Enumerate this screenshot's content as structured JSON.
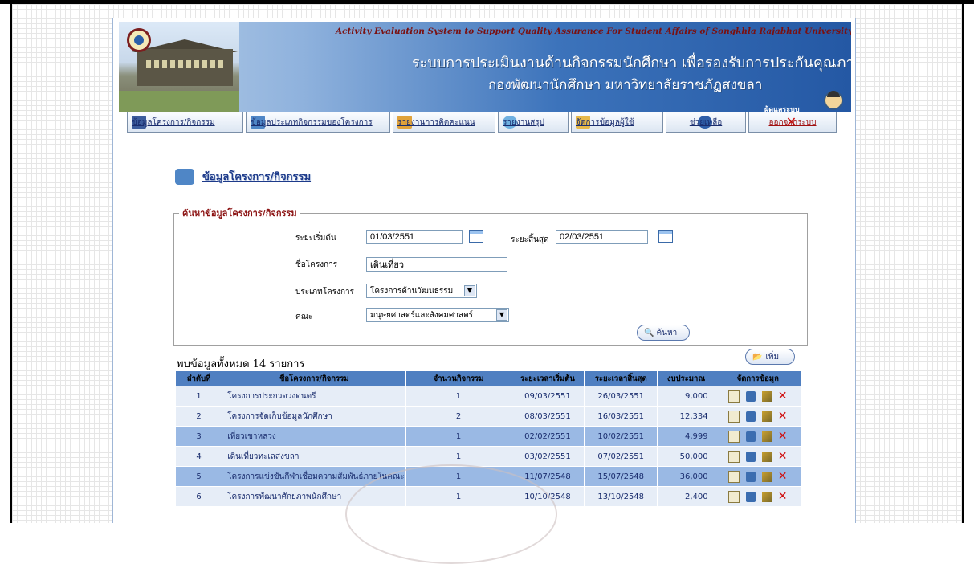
{
  "banner": {
    "title_en": "Activity Evaluation System to Support Quality Assurance For Student Affairs of Songkhla Rajabhat University",
    "title_th_1": "ระบบการประเมินงานด้านกิจกรรมนักศึกษา เพื่อรองรับการประกันคุณภาพ",
    "title_th_2": "กองพัฒนานักศึกษา มหาวิทยาลัยราชภัฏสงขลา",
    "user_label": "ผู้ดูแลระบบ"
  },
  "nav": [
    {
      "label": "ข้อมูลโครงการ/กิจกรรม",
      "icon": "monitor-icon"
    },
    {
      "label": "ข้อมูลประเภทกิจกรรมของโครงการ",
      "icon": "folder-icon"
    },
    {
      "label": "รายงานการคิดคะแนน",
      "icon": "report-icon"
    },
    {
      "label": "รายงานสรุป",
      "icon": "chart-icon"
    },
    {
      "label": "จัดการข้อมูลผู้ใช้",
      "icon": "users-icon"
    },
    {
      "label": "ช่วยเหลือ",
      "icon": "help-icon"
    },
    {
      "label": "ออกจากระบบ",
      "icon": "logout-icon"
    }
  ],
  "section_title": "ข้อมูลโครงการ/กิจกรรม",
  "search": {
    "legend": "ค้นหาข้อมูลโครงการ/กิจกรรม",
    "start_label": "ระยะเริ่มต้น",
    "start_value": "01/03/2551",
    "end_label": "ระยะสิ้นสุด",
    "end_value": "02/03/2551",
    "name_label": "ชื่อโครงการ",
    "name_value": "เดินเที่ยว",
    "type_label": "ประเภทโครงการ",
    "type_value": "โครงการด้านวัฒนธรรม",
    "faculty_label": "คณะ",
    "faculty_value": "มนุษยศาสตร์และสังคมศาสตร์",
    "search_button": "ค้นหา"
  },
  "results": {
    "count_text": "พบข้อมูลทั้งหมด 14 รายการ",
    "add_button": "เพิ่ม",
    "columns": [
      "ลำดับที่",
      "ชื่อโครงการ/กิจกรรม",
      "จำนวนกิจกรรม",
      "ระยะเวลาเริ่มต้น",
      "ระยะเวลาสิ้นสุด",
      "งบประมาณ",
      "จัดการข้อมูล"
    ],
    "rows": [
      {
        "no": "1",
        "name": "โครงการประกวดวงดนตรี",
        "activities": "1",
        "start": "09/03/2551",
        "end": "26/03/2551",
        "budget": "9,000"
      },
      {
        "no": "2",
        "name": "โครงการจัดเก็บข้อมูลนักศึกษา",
        "activities": "2",
        "start": "08/03/2551",
        "end": "16/03/2551",
        "budget": "12,334"
      },
      {
        "no": "3",
        "name": "เที่ยวเขาหลวง",
        "activities": "1",
        "start": "02/02/2551",
        "end": "10/02/2551",
        "budget": "4,999"
      },
      {
        "no": "4",
        "name": "เดินเที่ยวทะเลสงขลา",
        "activities": "1",
        "start": "03/02/2551",
        "end": "07/02/2551",
        "budget": "50,000"
      },
      {
        "no": "5",
        "name": "โครงการแข่งขันกีฬาเชื่อมความสัมพันธ์ภายในคณะ",
        "activities": "1",
        "start": "11/07/2548",
        "end": "15/07/2548",
        "budget": "36,000"
      },
      {
        "no": "6",
        "name": "โครงการพัฒนาศักยภาพนักศึกษา",
        "activities": "1",
        "start": "10/10/2548",
        "end": "13/10/2548",
        "budget": "2,400"
      }
    ]
  }
}
